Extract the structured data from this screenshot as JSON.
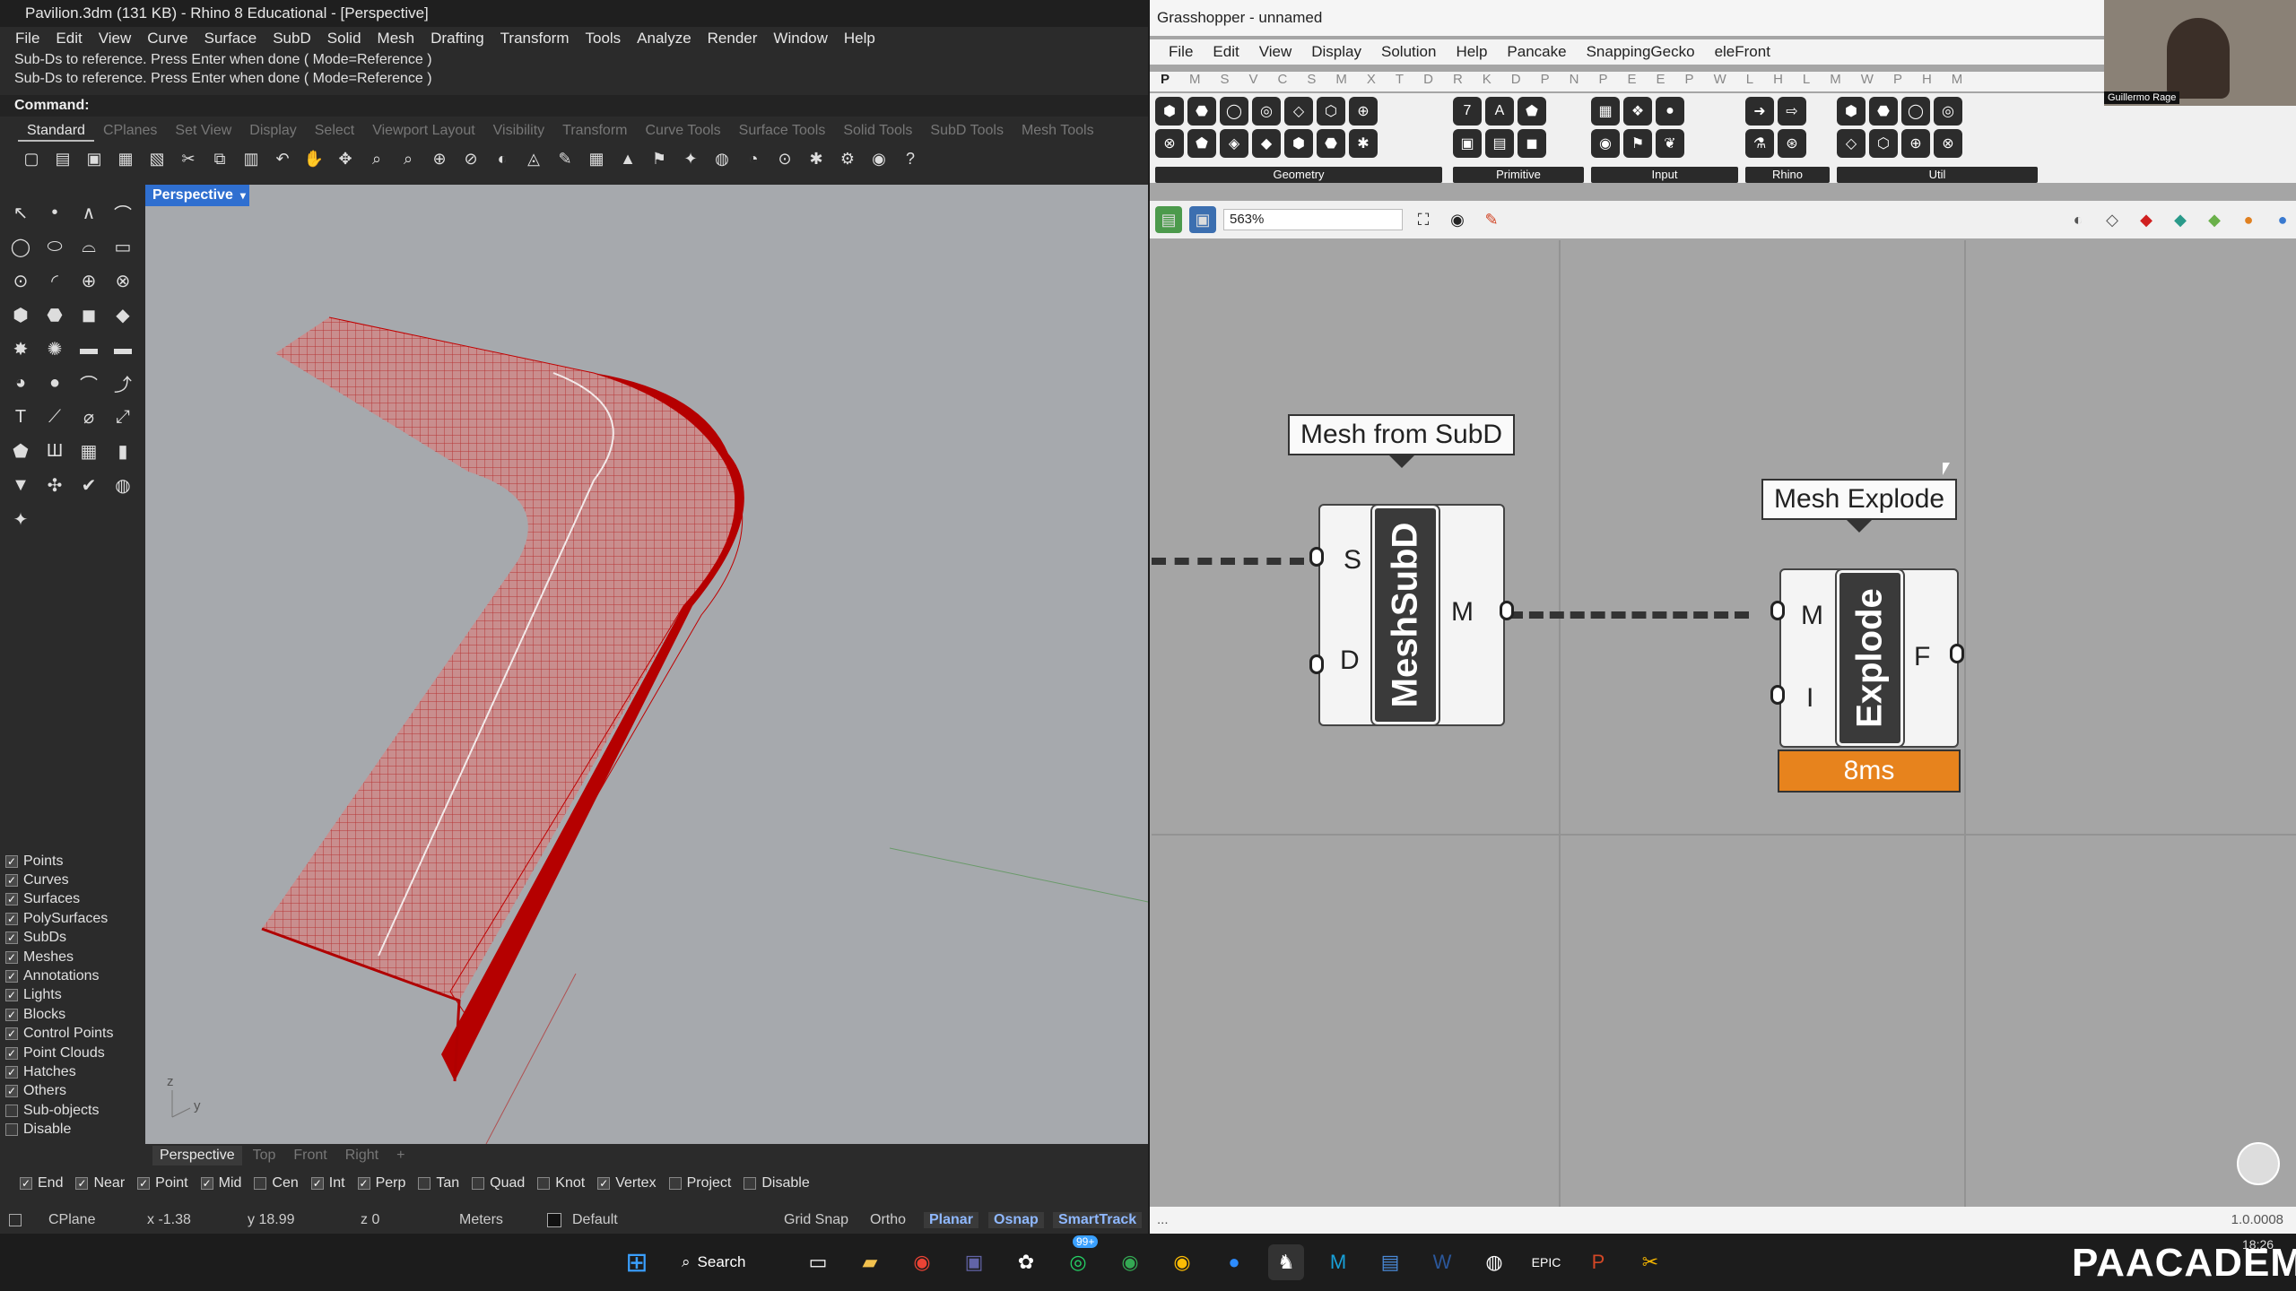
{
  "rhino": {
    "title": "Pavilion.3dm (131 KB) - Rhino 8 Educational - [Perspective]",
    "menu": [
      "File",
      "Edit",
      "View",
      "Curve",
      "Surface",
      "SubD",
      "Solid",
      "Mesh",
      "Drafting",
      "Transform",
      "Tools",
      "Analyze",
      "Render",
      "Window",
      "Help"
    ],
    "history": [
      "Sub-Ds to reference. Press Enter when done ( Mode=Reference )",
      "Sub-Ds to reference. Press Enter when done ( Mode=Reference )"
    ],
    "command_label": "Command:",
    "tabs": [
      "Standard",
      "CPlanes",
      "Set View",
      "Display",
      "Select",
      "Viewport Layout",
      "Visibility",
      "Transform",
      "Curve Tools",
      "Surface Tools",
      "Solid Tools",
      "SubD Tools",
      "Mesh Tools"
    ],
    "viewport_label": "Perspective",
    "layers": [
      {
        "label": "Points",
        "checked": true
      },
      {
        "label": "Curves",
        "checked": true
      },
      {
        "label": "Surfaces",
        "checked": true
      },
      {
        "label": "PolySurfaces",
        "checked": true
      },
      {
        "label": "SubDs",
        "checked": true
      },
      {
        "label": "Meshes",
        "checked": true
      },
      {
        "label": "Annotations",
        "checked": true
      },
      {
        "label": "Lights",
        "checked": true
      },
      {
        "label": "Blocks",
        "checked": true
      },
      {
        "label": "Control Points",
        "checked": true
      },
      {
        "label": "Point Clouds",
        "checked": true
      },
      {
        "label": "Hatches",
        "checked": true
      },
      {
        "label": "Others",
        "checked": true
      },
      {
        "label": "Sub-objects",
        "checked": false
      },
      {
        "label": "Disable",
        "checked": false
      }
    ],
    "viewport_tabs": [
      "Perspective",
      "Top",
      "Front",
      "Right",
      "+"
    ],
    "osnaps": [
      {
        "label": "End",
        "checked": true
      },
      {
        "label": "Near",
        "checked": true
      },
      {
        "label": "Point",
        "checked": true
      },
      {
        "label": "Mid",
        "checked": true
      },
      {
        "label": "Cen",
        "checked": false
      },
      {
        "label": "Int",
        "checked": true
      },
      {
        "label": "Perp",
        "checked": true
      },
      {
        "label": "Tan",
        "checked": false
      },
      {
        "label": "Quad",
        "checked": false
      },
      {
        "label": "Knot",
        "checked": false
      },
      {
        "label": "Vertex",
        "checked": true
      },
      {
        "label": "Project",
        "checked": false
      },
      {
        "label": "Disable",
        "checked": false
      }
    ],
    "status": {
      "cplane": "CPlane",
      "x": "x -1.38",
      "y": "y 18.99",
      "z": "z 0",
      "units": "Meters",
      "layer": "Default",
      "grid_snap": "Grid Snap",
      "ortho": "Ortho",
      "planar": "Planar",
      "osnap": "Osnap",
      "smarttrack": "SmartTrack"
    },
    "axis": {
      "z": "z",
      "y": "y"
    }
  },
  "grasshopper": {
    "title": "Grasshopper - unnamed",
    "menu": [
      "File",
      "Edit",
      "View",
      "Display",
      "Solution",
      "Help",
      "Pancake",
      "SnappingGecko",
      "eleFront"
    ],
    "category_tabs": [
      "P",
      "M",
      "S",
      "V",
      "C",
      "S",
      "M",
      "X",
      "T",
      "D",
      "R",
      "K",
      "D",
      "P",
      "N",
      "P",
      "E",
      "E",
      "P",
      "W",
      "L",
      "H",
      "L",
      "M",
      "W",
      "P",
      "H",
      "M"
    ],
    "ribbon_groups": [
      "Geometry",
      "Primitive",
      "Input",
      "Rhino",
      "Util"
    ],
    "zoom": "563%",
    "bubble_meshsubd": "Mesh from SubD",
    "bubble_explode": "Mesh Explode",
    "meshsubd": {
      "name": "MeshSubD",
      "in1": "S",
      "in2": "D",
      "out": "M"
    },
    "explode": {
      "name": "Explode",
      "in1": "M",
      "in2": "I",
      "out": "F",
      "timer": "8ms"
    },
    "version": "1.0.0008"
  },
  "webcam": {
    "name": "Guillermo Rage"
  },
  "taskbar": {
    "search": "Search",
    "badge": "99+",
    "brand": "PAACADEMY",
    "time": "18:26"
  },
  "colors": {
    "rhino_bg": "#2b2b2b",
    "viewport": "#a6a9ad",
    "mesh_red": "#c00000",
    "gh_canvas": "#a5a5a5",
    "timer": "#e7831d",
    "vp_label": "#2f6fd0"
  }
}
